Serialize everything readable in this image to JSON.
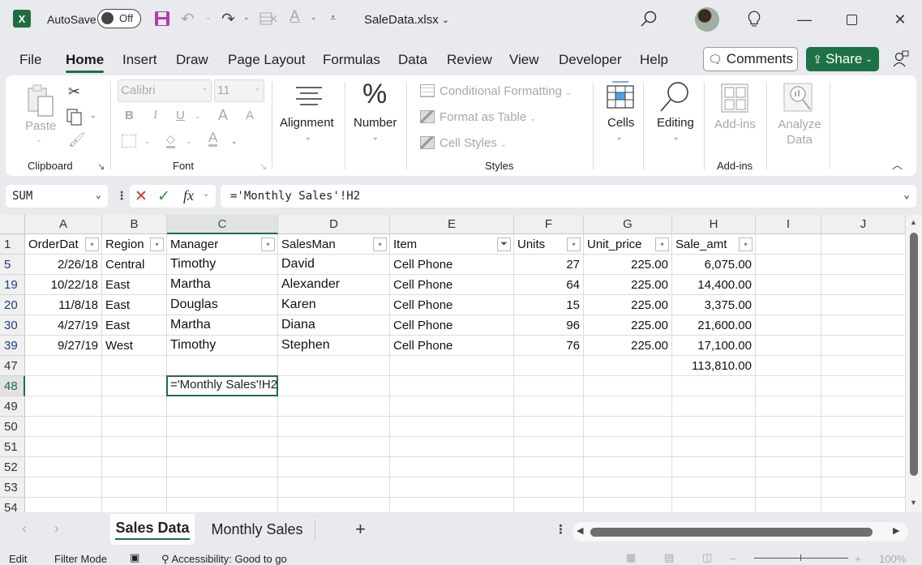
{
  "titlebar": {
    "app_logo": "X",
    "autosave_label": "AutoSave",
    "autosave_state": "Off",
    "filename": "SaleData.xlsx",
    "icons": [
      "save-icon",
      "undo-icon",
      "redo-icon",
      "sort-icon",
      "font-color-icon",
      "customize-qat-icon",
      "search-icon",
      "lightbulb-icon",
      "minimize-icon",
      "maximize-icon",
      "close-icon"
    ]
  },
  "menu": {
    "tabs": [
      "File",
      "Home",
      "Insert",
      "Draw",
      "Page Layout",
      "Formulas",
      "Data",
      "Review",
      "View",
      "Developer",
      "Help"
    ],
    "active_tab": "Home",
    "comments_label": "Comments",
    "share_label": "Share"
  },
  "ribbon": {
    "clipboard": {
      "label": "Clipboard",
      "paste": "Paste"
    },
    "font": {
      "label": "Font",
      "font_name": "Calibri",
      "font_size": "11",
      "bold": "B",
      "italic": "I",
      "underline": "U",
      "grow": "A",
      "shrink": "A",
      "color_letter": "A"
    },
    "alignment": {
      "label": "Alignment"
    },
    "number": {
      "label": "Number",
      "glyph": "%"
    },
    "styles": {
      "label": "Styles",
      "conditional_formatting": "Conditional Formatting",
      "format_as_table": "Format as Table",
      "cell_styles": "Cell Styles"
    },
    "cells": {
      "label": "Cells"
    },
    "editing": {
      "label": "Editing"
    },
    "addins": {
      "label": "Add-ins",
      "group_label": "Add-ins"
    },
    "analyze": {
      "line1": "Analyze",
      "line2": "Data"
    }
  },
  "formula_bar": {
    "name_box": "SUM",
    "formula": "='Monthly Sales'!H2",
    "fx": "fx"
  },
  "grid": {
    "columns": [
      "A",
      "B",
      "C",
      "D",
      "E",
      "F",
      "G",
      "H",
      "I",
      "J"
    ],
    "selected_column": "C",
    "headers": [
      "OrderDate",
      "Region",
      "Manager",
      "SalesMan",
      "Item",
      "Units",
      "Unit_price",
      "Sale_amt"
    ],
    "header_display": [
      "OrderDat",
      "Region",
      "Manager",
      "SalesMan",
      "Item",
      "Units",
      "Unit_price",
      "Sale_amt"
    ],
    "filtered_column": "Item",
    "rows": [
      {
        "row": "5",
        "cells": [
          "2/26/18",
          "Central",
          "Timothy",
          "David",
          "Cell Phone",
          "27",
          "225.00",
          "6,075.00"
        ]
      },
      {
        "row": "19",
        "cells": [
          "10/22/18",
          "East",
          "Martha",
          "Alexander",
          "Cell Phone",
          "64",
          "225.00",
          "14,400.00"
        ]
      },
      {
        "row": "20",
        "cells": [
          "11/8/18",
          "East",
          "Douglas",
          "Karen",
          "Cell Phone",
          "15",
          "225.00",
          "3,375.00"
        ]
      },
      {
        "row": "30",
        "cells": [
          "4/27/19",
          "East",
          "Martha",
          "Diana",
          "Cell Phone",
          "96",
          "225.00",
          "21,600.00"
        ]
      },
      {
        "row": "39",
        "cells": [
          "9/27/19",
          "West",
          "Timothy",
          "Stephen",
          "Cell Phone",
          "76",
          "225.00",
          "17,100.00"
        ]
      }
    ],
    "total_row": {
      "row": "47",
      "sale_amt_total": "113,810.00"
    },
    "active_row": "48",
    "active_cell_ref": "C48",
    "active_cell_content": "='Monthly Sales'!H2",
    "empty_rows": [
      "49",
      "50",
      "51",
      "52",
      "53",
      "54"
    ],
    "header_row": "1"
  },
  "sheets": {
    "tabs": [
      "Sales Data",
      "Monthly Sales"
    ],
    "active": "Sales Data",
    "add_label": "+"
  },
  "statusbar": {
    "mode": "Edit",
    "filter_mode": "Filter Mode",
    "accessibility": "Accessibility: Good to go",
    "zoom": "100%"
  }
}
